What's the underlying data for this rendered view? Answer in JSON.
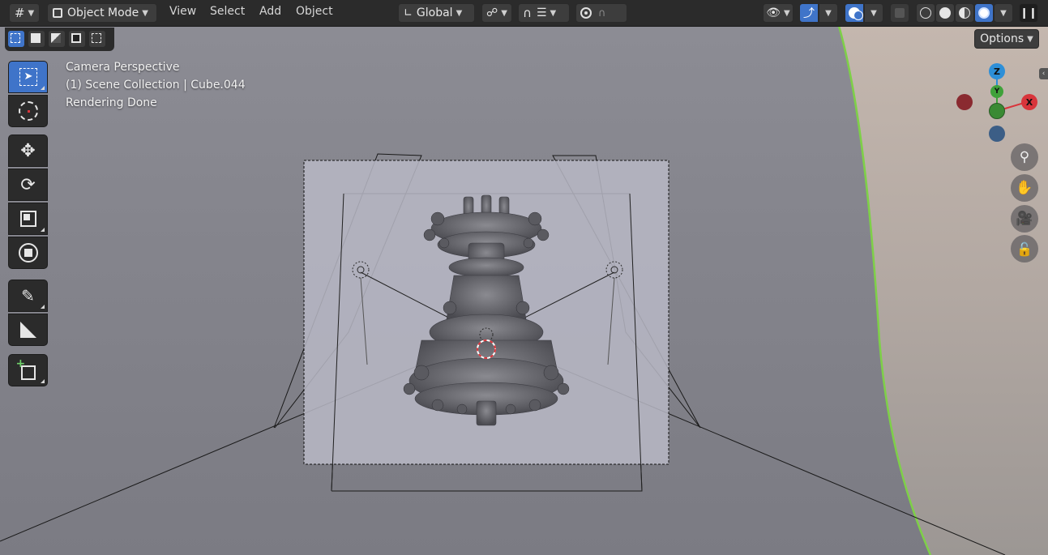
{
  "header": {
    "editor_type_icon": "grid-axes-icon",
    "mode_label": "Object Mode",
    "menus": [
      "View",
      "Select",
      "Add",
      "Object"
    ],
    "transform_orientation": "Global",
    "icons": [
      "transform-pivot-icon",
      "snap-icon",
      "proportional-edit-icon",
      "visibility-icon",
      "gizmo-icon",
      "overlay-icon",
      "xray-icon",
      "wireframe-shading-icon",
      "solid-shading-icon",
      "material-preview-icon",
      "rendered-shading-icon",
      "pause-icon"
    ]
  },
  "toolbar_options": {
    "label": "Options"
  },
  "viewport_info": {
    "line1": "Camera Perspective",
    "line2": "(1) Scene Collection | Cube.044",
    "line3": "Rendering Done"
  },
  "tools": [
    "select-box-tool",
    "cursor-tool",
    "move-tool",
    "rotate-tool",
    "scale-tool",
    "transform-tool",
    "annotate-tool",
    "measure-tool",
    "add-cube-tool"
  ],
  "gizmo": {
    "z": "Z",
    "y": "Y",
    "x": "X"
  },
  "colors": {
    "accent": "#3f74c9",
    "header": "#2b2b2b",
    "x_axis": "#d8353b",
    "y_axis": "#3fa13a",
    "z_axis": "#2d8fd8"
  }
}
